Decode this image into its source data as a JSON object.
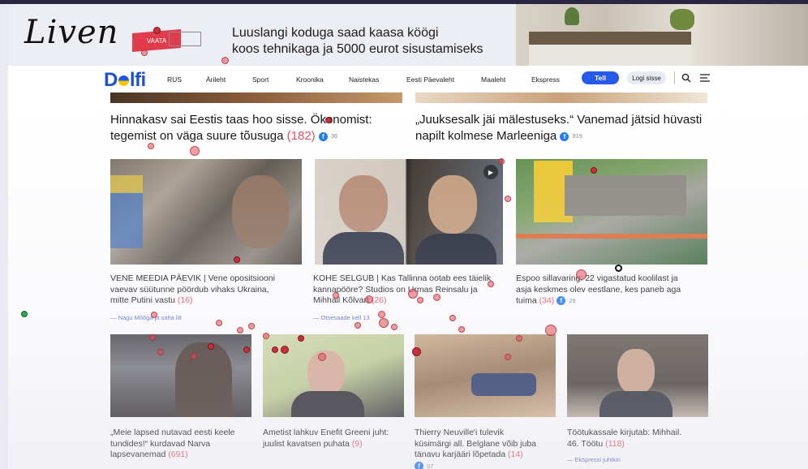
{
  "ad": {
    "logo": "Liven",
    "cta": "VAATA",
    "line1": "Luuslangi koduga saad kaasa köögi",
    "line2": "koos tehnikaga ja 5000 eurot sisustamiseks",
    "close": "✕"
  },
  "nav": {
    "brand_left": "D",
    "brand_right": "lfi",
    "items": [
      "RUS",
      "Ärileht",
      "Sport",
      "Kroonika",
      "Naistekas",
      "Eesti Päevaleht",
      "Maaleht",
      "Ekspress"
    ],
    "subscribe": "Tell",
    "login": "Logi sisse",
    "accent": "#2659e8"
  },
  "row1": [
    {
      "line1": "Hinnakasv sai Eestis taas hoo sisse. Ökonomist:",
      "line2": "tegemist on väga suure tõusuga",
      "count": "(182)",
      "fb": "36"
    },
    {
      "line1": "„Juuksesalk jäi mälestuseks.“ Vanemad jätsid hüvasti",
      "line2": "napilt kolmese Marleeniga",
      "fb": "919"
    }
  ],
  "row2": [
    {
      "l1": "VENE MEEDIA PÄEVIK | Vene opositsiooni",
      "l2": "vaevav süütunne pöördub vihaks Ukraina,",
      "l3": "mitte Putini vastu",
      "count": "(16)",
      "byline": "— Nagu Mõõga ja saha lilt"
    },
    {
      "l1": "KOHE SELGUB | Kas Tallinna ootab ees täielik",
      "l2": "kannapööre? Studios on Urmas Reinsalu ja",
      "l3": "Mihhail Kõlvart",
      "count": "(26)",
      "byline": "— Otsesaade kell 13"
    },
    {
      "l1": "Espoo sillavaring: 22 vigastatud koolilast ja",
      "l2": "asja keskmes olev eestlane, kes paneb aga",
      "l3": "tuima",
      "count": "(34)",
      "fb": "28"
    }
  ],
  "row3": [
    {
      "l1": "„Meie lapsed nutavad eesti keele",
      "l2": "tundides!“ kurdavad Narva",
      "l3": "lapsevanemad",
      "count": "(691)"
    },
    {
      "l1": "Ametist lahkuv Enefit Greeni juht:",
      "l2": "juulist kavatsen puhata",
      "count": "(9)"
    },
    {
      "l1": "Thierry Neuville'i tulevik",
      "l2": "küsimärgi all. Belglane võib juba",
      "l3": "tänavu karjääri lõpetada",
      "count": "(14)",
      "fb": "97"
    },
    {
      "l1": "Töötukassale kirjutab: Mihhail.",
      "l2": "46. Töötu",
      "count": "(118)",
      "byline": "— Ekspressi juhtkiri"
    }
  ]
}
